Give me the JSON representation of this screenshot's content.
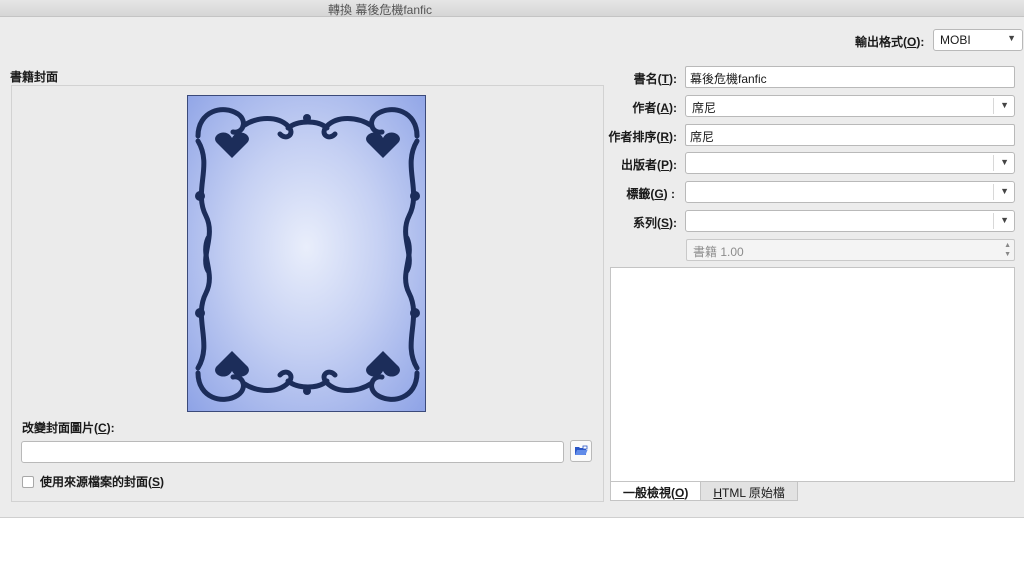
{
  "window": {
    "title": "轉換 幕後危機fanfic"
  },
  "output_format": {
    "label_prefix": "輸出格式(",
    "label_key": "O",
    "label_suffix": "):",
    "value": "MOBI"
  },
  "cover": {
    "section_title": "書籍封面",
    "change_label_prefix": "改變封面圖片(",
    "change_label_key": "C",
    "change_label_suffix": "):",
    "path_value": "",
    "use_source_prefix": "使用來源檔案的封面(",
    "use_source_key": "S",
    "use_source_suffix": ")",
    "use_source_checked": false
  },
  "fields": {
    "title": {
      "label_prefix": "書名(",
      "label_key": "T",
      "label_suffix": "):",
      "value": "幕後危機fanfic"
    },
    "author": {
      "label_prefix": "作者(",
      "label_key": "A",
      "label_suffix": "):",
      "value": "席尼"
    },
    "author_sort": {
      "label_prefix": "作者排序(",
      "label_key": "R",
      "label_suffix": "):",
      "value": "席尼"
    },
    "publisher": {
      "label_prefix": "出版者(",
      "label_key": "P",
      "label_suffix": "):",
      "value": ""
    },
    "tags": {
      "label_prefix": "標籤(",
      "label_key": "G",
      "label_suffix": ") :",
      "value": ""
    },
    "series": {
      "label_prefix": "系列(",
      "label_key": "S",
      "label_suffix": "):",
      "value": ""
    },
    "series_index": {
      "value": "書籍 1.00"
    }
  },
  "comments": {
    "tab_normal_prefix": "一般檢視(",
    "tab_normal_key": "O",
    "tab_normal_suffix": ")",
    "tab_html_key": "H",
    "tab_html_rest": "TML 原始檔"
  },
  "icons": {
    "browse": "folder-open-icon",
    "dropdown": "chevron-down-icon"
  },
  "colors": {
    "cover_gradient_center": "#e9eefb",
    "cover_gradient_edge": "#8ea3e6",
    "cover_ornament": "#1c2d5a"
  }
}
